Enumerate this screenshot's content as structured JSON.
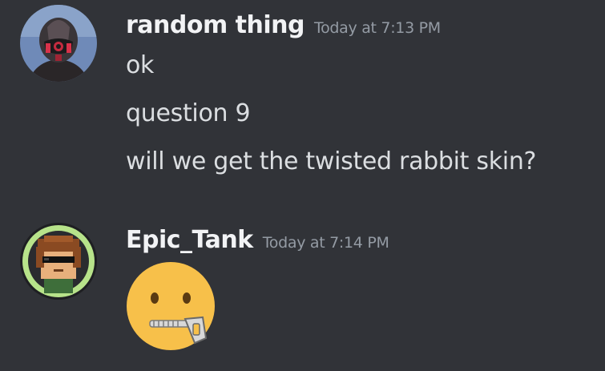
{
  "messages": [
    {
      "author": "random thing",
      "timestamp": "Today at 7:13 PM",
      "avatar_icon": "masked-character-avatar",
      "lines": [
        "ok",
        "question 9",
        "will we get the twisted rabbit skin?"
      ]
    },
    {
      "author": "Epic_Tank",
      "timestamp": "Today at 7:14 PM",
      "avatar_icon": "pixel-character-with-sunglasses-avatar",
      "emoji": "zipper-mouth-face-emoji"
    }
  ],
  "colors": {
    "background": "#313338",
    "username": "#f2f3f5",
    "text": "#dbdee1",
    "timestamp": "#949ba4",
    "emoji_yellow": "#f7c04a"
  }
}
